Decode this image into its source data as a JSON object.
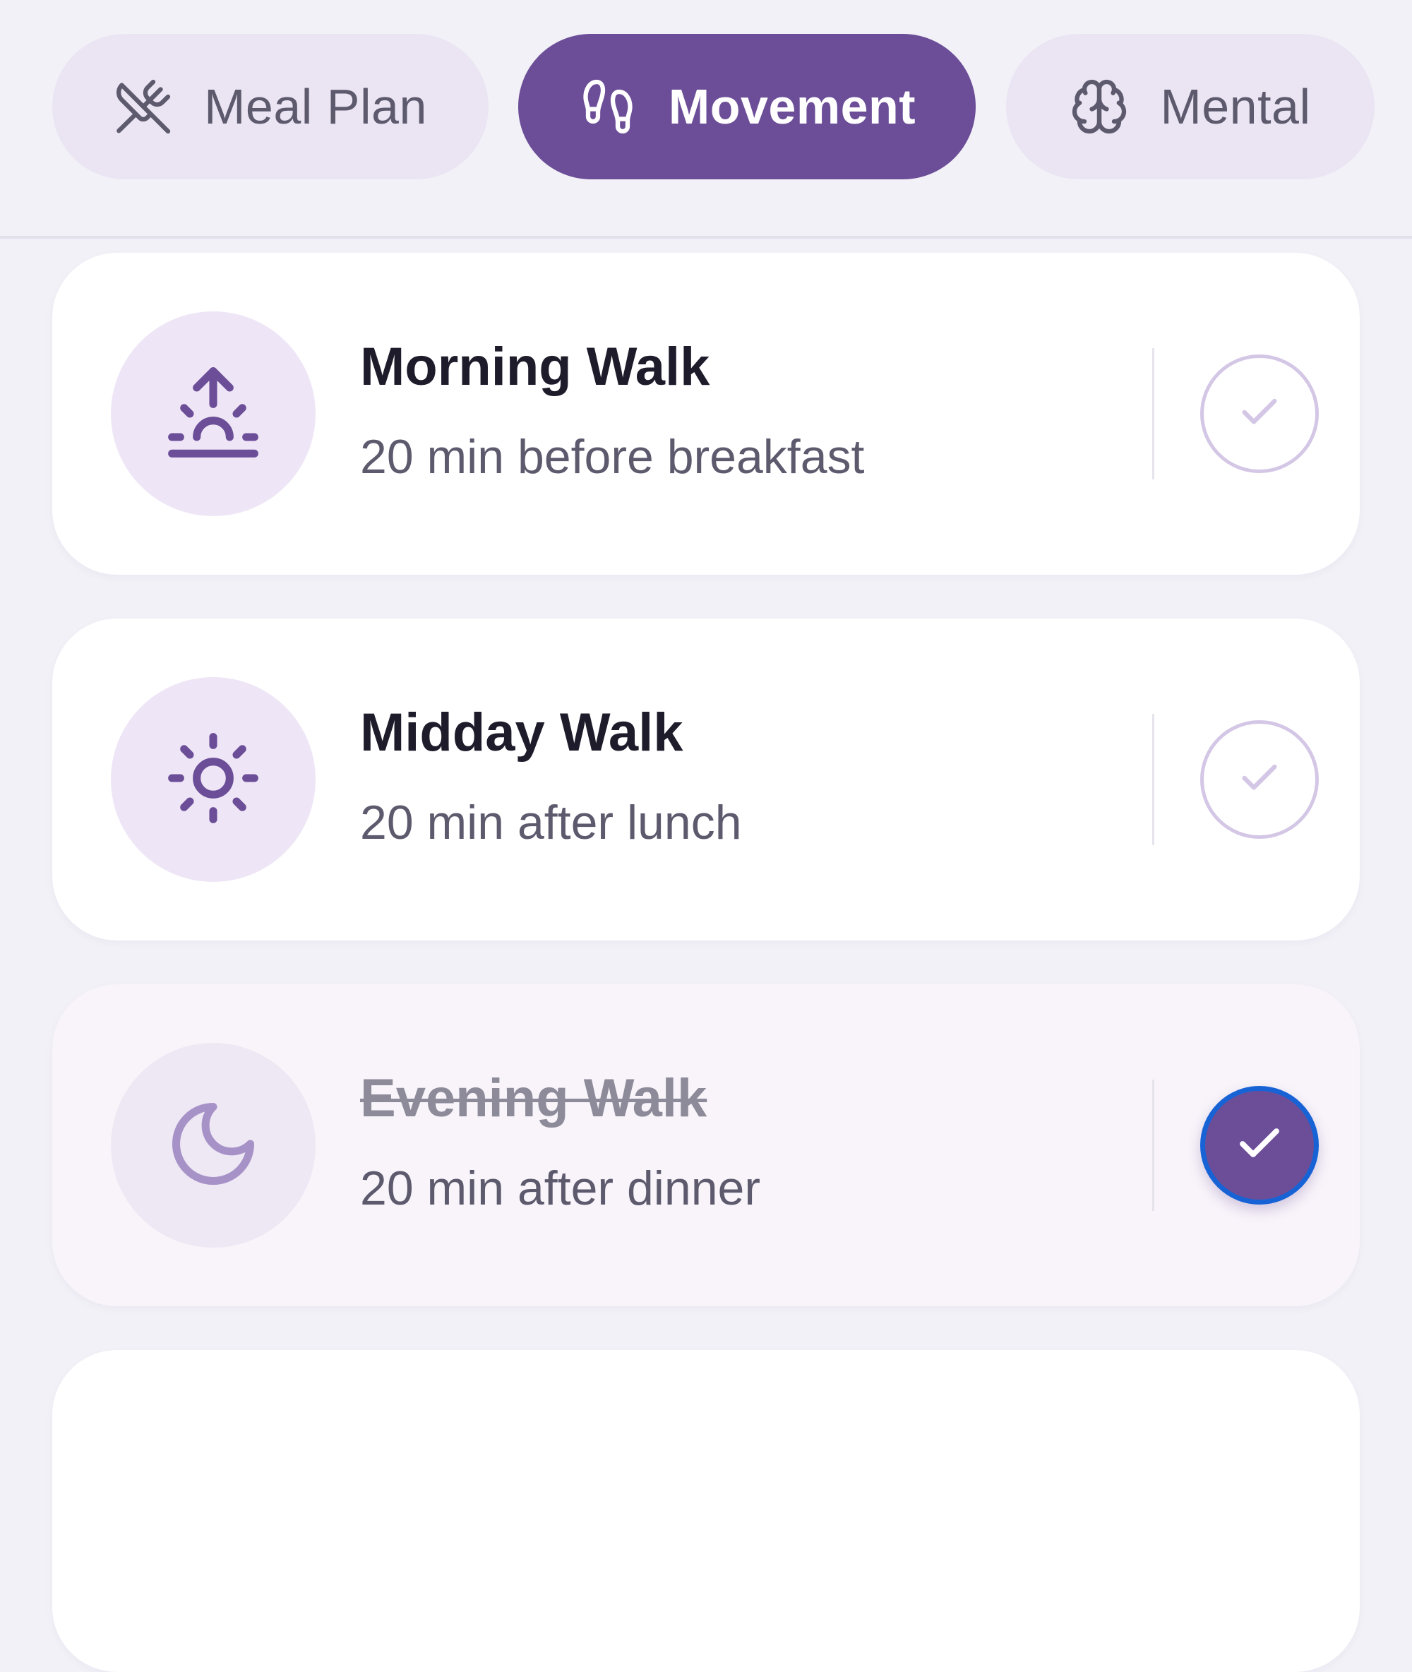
{
  "tabs": [
    {
      "label": "Meal Plan",
      "icon": "utensils-crossed-icon",
      "active": false
    },
    {
      "label": "Movement",
      "icon": "footprints-icon",
      "active": true
    },
    {
      "label": "Mental",
      "icon": "brain-icon",
      "active": false
    }
  ],
  "activities": [
    {
      "title": "Morning Walk",
      "subtitle": "20 min before breakfast",
      "icon": "sunrise-icon",
      "completed": false
    },
    {
      "title": "Midday Walk",
      "subtitle": "20 min after lunch",
      "icon": "sun-icon",
      "completed": false
    },
    {
      "title": "Evening Walk",
      "subtitle": "20 min after dinner",
      "icon": "moon-icon",
      "completed": true
    }
  ],
  "colors": {
    "accent": "#6C4E98",
    "background": "#F2F1F7",
    "tab_inactive_bg": "#EBE5F3",
    "icon_circle_bg": "#EEE6F6",
    "focus_ring": "#1763D6"
  }
}
